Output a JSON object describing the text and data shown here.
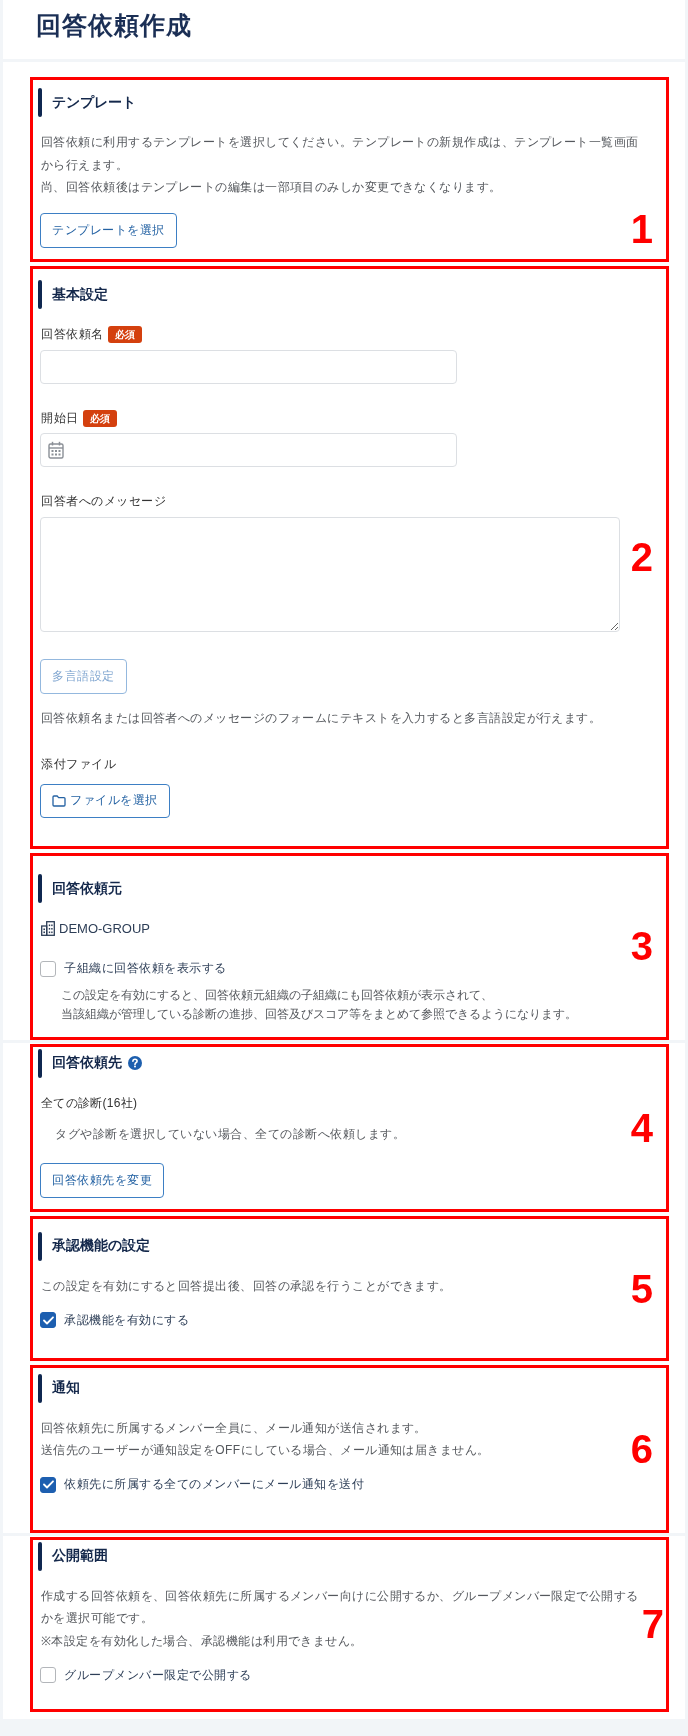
{
  "page": {
    "title": "回答依頼作成"
  },
  "sections": [
    {
      "callout": "1",
      "heading": "テンプレート",
      "help": false,
      "items": [
        {
          "kind": "paragraph",
          "lines": [
            "回答依頼に利用するテンプレートを選択してください。テンプレートの新規作成は、テンプレート一覧画面",
            "から行えます。",
            "尚、回答依頼後はテンプレートの編集は一部項目のみしか変更できなくなります。"
          ]
        },
        {
          "kind": "button",
          "label": "テンプレートを選択",
          "disabled": false
        }
      ]
    },
    {
      "callout": "2",
      "heading": "基本設定",
      "help": false,
      "items": [
        {
          "kind": "text_input",
          "label": "回答依頼名",
          "badge": "必須"
        },
        {
          "kind": "date_input",
          "label": "開始日",
          "badge": "必須"
        },
        {
          "kind": "textarea",
          "label": "回答者へのメッセージ"
        },
        {
          "kind": "button",
          "label": "多言語設定",
          "disabled": true
        },
        {
          "kind": "hint",
          "text": "回答依頼名または回答者へのメッセージのフォームにテキストを入力すると多言語設定が行えます。"
        },
        {
          "kind": "file_button",
          "label": "添付ファイル",
          "button": "ファイルを選択"
        }
      ]
    },
    {
      "callout": "3",
      "heading": "回答依頼元",
      "help": false,
      "items": [
        {
          "kind": "organization",
          "name": "DEMO-GROUP"
        },
        {
          "kind": "checkbox",
          "label": "子組織に回答依頼を表示する",
          "checked": false,
          "note": [
            "この設定を有効にすると、回答依頼元組織の子組織にも回答依頼が表示されて、",
            "当該組織が管理している診断の進捗、回答及びスコア等をまとめて参照できるようになります。"
          ]
        }
      ]
    },
    {
      "callout": "4",
      "heading": "回答依頼先",
      "help": true,
      "items": [
        {
          "kind": "target",
          "title": "全ての診断(16社)",
          "note": "タグや診断を選択していない場合、全ての診断へ依頼します。"
        },
        {
          "kind": "button",
          "label": "回答依頼先を変更",
          "disabled": false
        }
      ]
    },
    {
      "callout": "5",
      "heading": "承認機能の設定",
      "help": false,
      "items": [
        {
          "kind": "paragraph",
          "lines": [
            "この設定を有効にすると回答提出後、回答の承認を行うことができます。"
          ]
        },
        {
          "kind": "checkbox",
          "label": "承認機能を有効にする",
          "checked": true
        }
      ]
    },
    {
      "callout": "6",
      "heading": "通知",
      "help": false,
      "items": [
        {
          "kind": "paragraph",
          "lines": [
            "回答依頼先に所属するメンバー全員に、メール通知が送信されます。",
            "送信先のユーザーが通知設定をOFFにしている場合、メール通知は届きません。"
          ]
        },
        {
          "kind": "checkbox",
          "label": "依頼先に所属する全てのメンバーにメール通知を送付",
          "checked": true
        }
      ]
    },
    {
      "callout": "7",
      "heading": "公開範囲",
      "help": false,
      "items": [
        {
          "kind": "paragraph",
          "lines": [
            "作成する回答依頼を、回答依頼先に所属するメンバー向けに公開するか、グループメンバー限定で公開する",
            "かを選択可能です。",
            "※本設定を有効化した場合、承認機能は利用できません。"
          ]
        },
        {
          "kind": "checkbox",
          "label": "グループメンバー限定で公開する",
          "checked": false
        }
      ]
    }
  ]
}
